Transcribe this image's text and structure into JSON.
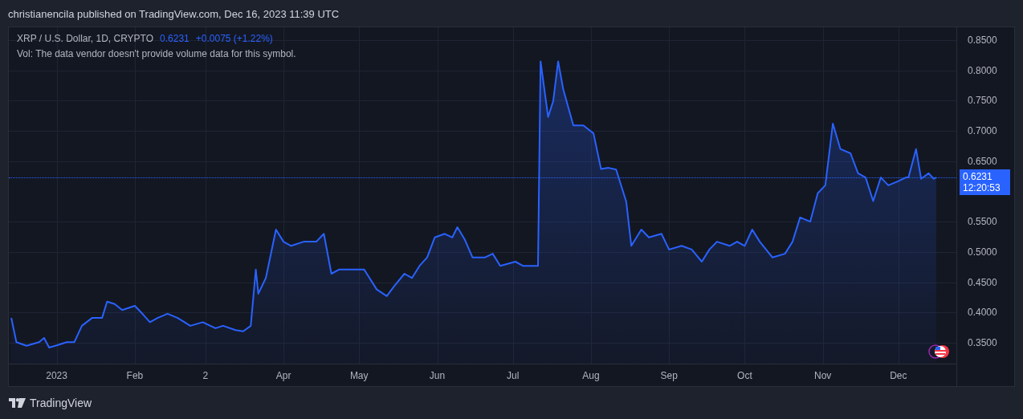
{
  "header": {
    "publisher_line": "christianencila published on TradingView.com, Dec 16, 2023 11:39 UTC"
  },
  "chart": {
    "legend": {
      "symbol": "XRP / U.S. Dollar, 1D, CRYPTO",
      "price": "0.6231",
      "change": "+0.0075 (+1.22%)",
      "volume_note": "Vol: The data vendor doesn't provide volume data for this symbol."
    },
    "last_price_label": {
      "price": "0.6231",
      "countdown": "12:20:53"
    },
    "chart_data": {
      "type": "area",
      "x": [
        "2022-12-14",
        "2022-12-16",
        "2022-12-20",
        "2022-12-25",
        "2022-12-27",
        "2022-12-29",
        "2023-01-02",
        "2023-01-05",
        "2023-01-08",
        "2023-01-11",
        "2023-01-15",
        "2023-01-19",
        "2023-01-21",
        "2023-01-24",
        "2023-01-27",
        "2023-02-01",
        "2023-02-04",
        "2023-02-07",
        "2023-02-10",
        "2023-02-14",
        "2023-02-18",
        "2023-02-23",
        "2023-02-28",
        "2023-03-05",
        "2023-03-08",
        "2023-03-13",
        "2023-03-16",
        "2023-03-19",
        "2023-03-21",
        "2023-03-22",
        "2023-03-25",
        "2023-03-29",
        "2023-04-01",
        "2023-04-04",
        "2023-04-09",
        "2023-04-14",
        "2023-04-17",
        "2023-04-20",
        "2023-04-23",
        "2023-04-28",
        "2023-05-03",
        "2023-05-08",
        "2023-05-12",
        "2023-05-15",
        "2023-05-19",
        "2023-05-22",
        "2023-05-25",
        "2023-05-28",
        "2023-05-31",
        "2023-06-04",
        "2023-06-07",
        "2023-06-09",
        "2023-06-12",
        "2023-06-15",
        "2023-06-20",
        "2023-06-23",
        "2023-06-26",
        "2023-07-02",
        "2023-07-05",
        "2023-07-09",
        "2023-07-11",
        "2023-07-12",
        "2023-07-15",
        "2023-07-17",
        "2023-07-19",
        "2023-07-21",
        "2023-07-25",
        "2023-07-29",
        "2023-08-02",
        "2023-08-05",
        "2023-08-08",
        "2023-08-11",
        "2023-08-15",
        "2023-08-17",
        "2023-08-21",
        "2023-08-24",
        "2023-08-29",
        "2023-09-01",
        "2023-09-06",
        "2023-09-10",
        "2023-09-14",
        "2023-09-17",
        "2023-09-20",
        "2023-09-25",
        "2023-09-28",
        "2023-10-01",
        "2023-10-04",
        "2023-10-07",
        "2023-10-12",
        "2023-10-17",
        "2023-10-20",
        "2023-10-23",
        "2023-10-27",
        "2023-10-30",
        "2023-11-02",
        "2023-11-05",
        "2023-11-08",
        "2023-11-12",
        "2023-11-15",
        "2023-11-18",
        "2023-11-21",
        "2023-11-24",
        "2023-11-27",
        "2023-12-01",
        "2023-12-04",
        "2023-12-05",
        "2023-12-08",
        "2023-12-10",
        "2023-12-13",
        "2023-12-15",
        "2023-12-16"
      ],
      "series": [
        {
          "color": "#2962ff",
          "values": [
            0.391,
            0.351,
            0.345,
            0.351,
            0.358,
            0.342,
            0.347,
            0.351,
            0.351,
            0.378,
            0.391,
            0.391,
            0.418,
            0.414,
            0.404,
            0.411,
            0.398,
            0.384,
            0.391,
            0.398,
            0.391,
            0.378,
            0.384,
            0.374,
            0.378,
            0.371,
            0.369,
            0.378,
            0.471,
            0.431,
            0.457,
            0.537,
            0.517,
            0.51,
            0.517,
            0.517,
            0.53,
            0.464,
            0.471,
            0.471,
            0.471,
            0.438,
            0.427,
            0.444,
            0.464,
            0.457,
            0.477,
            0.491,
            0.524,
            0.53,
            0.524,
            0.541,
            0.52,
            0.491,
            0.491,
            0.497,
            0.477,
            0.484,
            0.477,
            0.477,
            0.477,
            0.815,
            0.723,
            0.749,
            0.815,
            0.769,
            0.709,
            0.709,
            0.696,
            0.637,
            0.639,
            0.636,
            0.583,
            0.51,
            0.537,
            0.524,
            0.53,
            0.504,
            0.51,
            0.504,
            0.484,
            0.504,
            0.517,
            0.51,
            0.517,
            0.51,
            0.537,
            0.517,
            0.491,
            0.497,
            0.517,
            0.557,
            0.55,
            0.597,
            0.61,
            0.712,
            0.67,
            0.663,
            0.63,
            0.623,
            0.584,
            0.623,
            0.61,
            0.617,
            0.623,
            0.623,
            0.67,
            0.621,
            0.63,
            0.621,
            0.623
          ]
        }
      ],
      "grid": true,
      "xlim": [
        "2022-12-13",
        "2023-12-24"
      ],
      "ylim": [
        0.3155,
        0.8712
      ],
      "xticks": [
        {
          "value": "2023-01-01",
          "label": "2023"
        },
        {
          "value": "2023-02-01",
          "label": "Feb"
        },
        {
          "value": "2023-03-01",
          "label": "2"
        },
        {
          "value": "2023-04-01",
          "label": "Apr"
        },
        {
          "value": "2023-05-01",
          "label": "May"
        },
        {
          "value": "2023-06-01",
          "label": "Jun"
        },
        {
          "value": "2023-07-01",
          "label": "Jul"
        },
        {
          "value": "2023-08-01",
          "label": "Aug"
        },
        {
          "value": "2023-09-01",
          "label": "Sep"
        },
        {
          "value": "2023-10-01",
          "label": "Oct"
        },
        {
          "value": "2023-11-01",
          "label": "Nov"
        },
        {
          "value": "2023-12-01",
          "label": "Dec"
        }
      ],
      "yticks": [
        {
          "value": 0.35,
          "label": "0.3500"
        },
        {
          "value": 0.4,
          "label": "0.4000"
        },
        {
          "value": 0.45,
          "label": "0.4500"
        },
        {
          "value": 0.5,
          "label": "0.5000"
        },
        {
          "value": 0.55,
          "label": "0.5500"
        },
        {
          "value": 0.65,
          "label": "0.6500"
        },
        {
          "value": 0.7,
          "label": "0.7000"
        },
        {
          "value": 0.75,
          "label": "0.7500"
        },
        {
          "value": 0.8,
          "label": "0.8000"
        },
        {
          "value": 0.85,
          "label": "0.8500"
        }
      ]
    }
  },
  "footer": {
    "brand": "TradingView"
  }
}
